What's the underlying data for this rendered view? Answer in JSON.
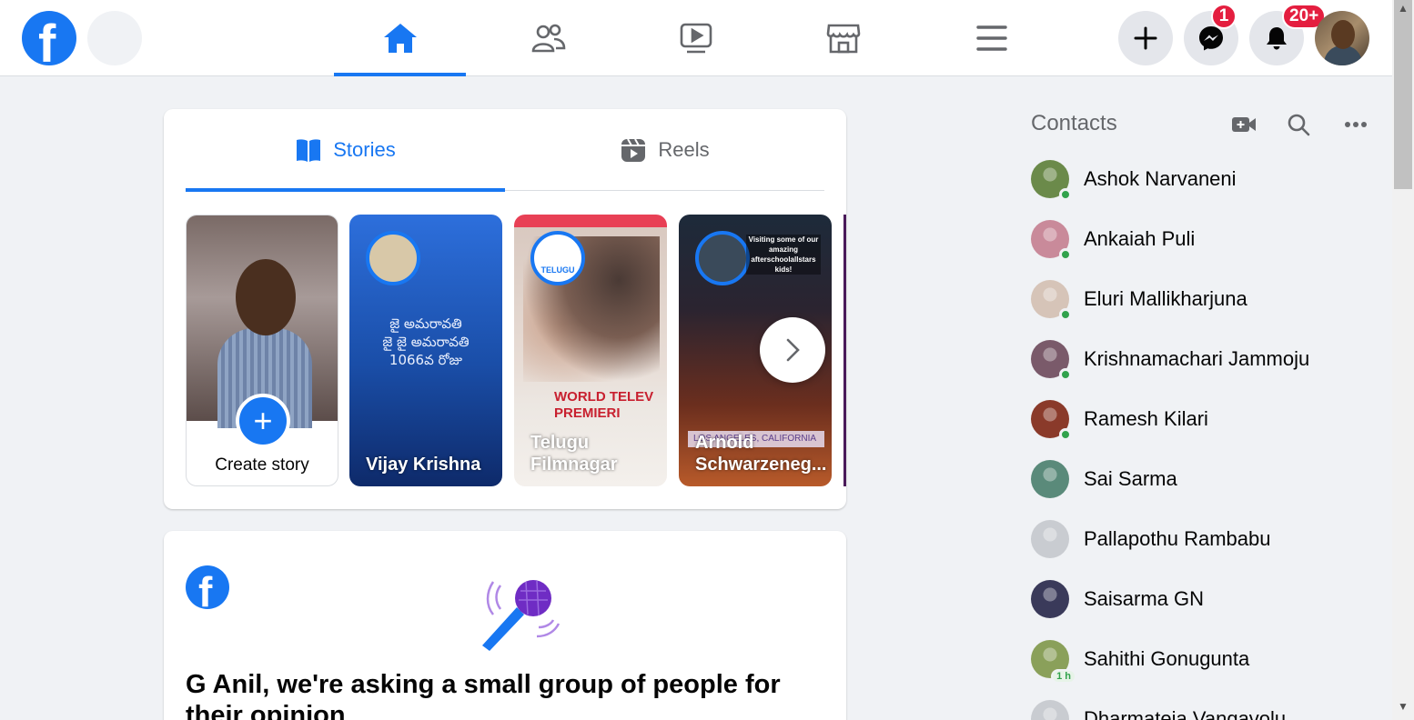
{
  "nav": {
    "badges": {
      "messenger": "1",
      "notifications": "20+"
    }
  },
  "stories_card": {
    "tabs": [
      {
        "label": "Stories",
        "active": true
      },
      {
        "label": "Reels",
        "active": false
      }
    ],
    "create_story_label": "Create story",
    "stories": [
      {
        "name": "Vijay Krishna",
        "body_lines": [
          "జై అమరావతి",
          "జై జై అమరావతి",
          "1066వ రోజు"
        ]
      },
      {
        "name": "Telugu Filmnagar",
        "ring_label": "TELUGU",
        "poster_text": [
          "WORLD TELEV",
          "PREMIERI"
        ]
      },
      {
        "name": "Arnold Schwarzeneg...",
        "overlay_text": "Visiting some of our amazing afterschoolallstars kids!",
        "location": "LOS ANGELES, CALIFORNIA"
      }
    ]
  },
  "survey": {
    "title": "G Anil, we're asking a small group of people for their opinion"
  },
  "contacts": {
    "header": "Contacts",
    "items": [
      {
        "name": "Ashok Narvaneni",
        "online": true,
        "color": "#6b8a4a"
      },
      {
        "name": "Ankaiah Puli",
        "online": true,
        "color": "#c98a9a"
      },
      {
        "name": "Eluri Mallikharjuna",
        "online": true,
        "color": "#d6c4b8"
      },
      {
        "name": "Krishnamachari Jammoju",
        "online": true,
        "color": "#7a5a6a"
      },
      {
        "name": "Ramesh Kilari",
        "online": true,
        "color": "#8a3a2a"
      },
      {
        "name": "Sai Sarma",
        "online": false,
        "color": "#5a8a7a"
      },
      {
        "name": "Pallapothu Rambabu",
        "online": false,
        "color": "#c9ccd1"
      },
      {
        "name": "Saisarma GN",
        "online": false,
        "color": "#3a3a5a"
      },
      {
        "name": "Sahithi Gonugunta",
        "online": false,
        "time": "1 h",
        "color": "#8aa05a"
      },
      {
        "name": "Dharmateja Vangavolu",
        "online": false,
        "color": "#c9ccd1"
      }
    ]
  }
}
